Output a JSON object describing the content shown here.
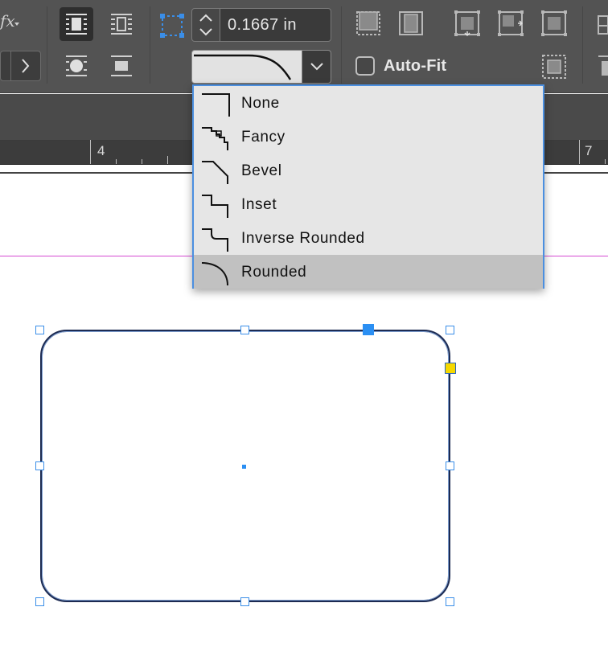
{
  "control_bar": {
    "fx_label": "fx",
    "offset_value": "0.1667 in",
    "auto_fit_label": "Auto-Fit",
    "auto_fit_checked": false,
    "corner_shape_selected": "Rounded"
  },
  "corner_menu": {
    "items": [
      {
        "label": "None",
        "icon": "corner-none-icon"
      },
      {
        "label": "Fancy",
        "icon": "corner-fancy-icon"
      },
      {
        "label": "Bevel",
        "icon": "corner-bevel-icon"
      },
      {
        "label": "Inset",
        "icon": "corner-inset-icon"
      },
      {
        "label": "Inverse Rounded",
        "icon": "corner-inverse-rounded-icon"
      },
      {
        "label": "Rounded",
        "icon": "corner-rounded-icon",
        "selected": true
      }
    ]
  },
  "ruler": {
    "labels": [
      "4",
      "7"
    ]
  },
  "colors": {
    "selection": "#2b8ff3",
    "margin_guide": "#d54bd2",
    "corner_handle": "#f5d800",
    "menu_border": "#4b8fe0"
  }
}
